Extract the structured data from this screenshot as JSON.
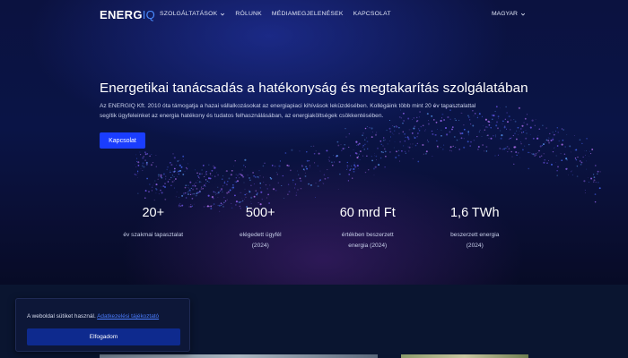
{
  "brand": {
    "logo_main": "ENERG",
    "logo_accent": "IQ"
  },
  "nav": {
    "items": [
      {
        "label": "SZOLGÁLTATÁSOK",
        "has_dropdown": true
      },
      {
        "label": "RÓLUNK",
        "has_dropdown": false
      },
      {
        "label": "MÉDIAMEGJELENÉSEK",
        "has_dropdown": false
      },
      {
        "label": "KAPCSOLAT",
        "has_dropdown": false
      }
    ],
    "language": "MAGYAR"
  },
  "hero": {
    "title": "Energetikai tanácsadás a hatékonyság és megtakarítás szolgálatában",
    "description": "Az ENERGIQ Kft. 2010 óta támogatja a hazai vállalkozásokat az energiapiaci kihívások leküzdésében. Kollégáink több mint 20 év tapasztalattal segítik ügyfeleinket az energia hatékony és tudatos felhasználásában, az energiaköltségek csökkentésében.",
    "cta_label": "Kapcsolat"
  },
  "stats": [
    {
      "value": "20+",
      "label_line1": "év szakmai tapasztalat",
      "label_line2": ""
    },
    {
      "value": "500+",
      "label_line1": "elégedett ügyfél",
      "label_line2": "(2024)"
    },
    {
      "value": "60 mrd Ft",
      "label_line1": "értékben beszerzett",
      "label_line2": "energia (2024)"
    },
    {
      "value": "1,6 TWh",
      "label_line1": "beszerzett energia",
      "label_line2": "(2024)"
    }
  ],
  "cookie": {
    "text": "A weboldal sütiket használ.",
    "link_text": "Adatkezelési tájékoztató",
    "accept_label": "Elfogadom"
  },
  "colors": {
    "accent": "#1a3dff",
    "logo_accent": "#4a8cff",
    "background": "#050b22",
    "cookie_button": "#0e2a8e"
  }
}
